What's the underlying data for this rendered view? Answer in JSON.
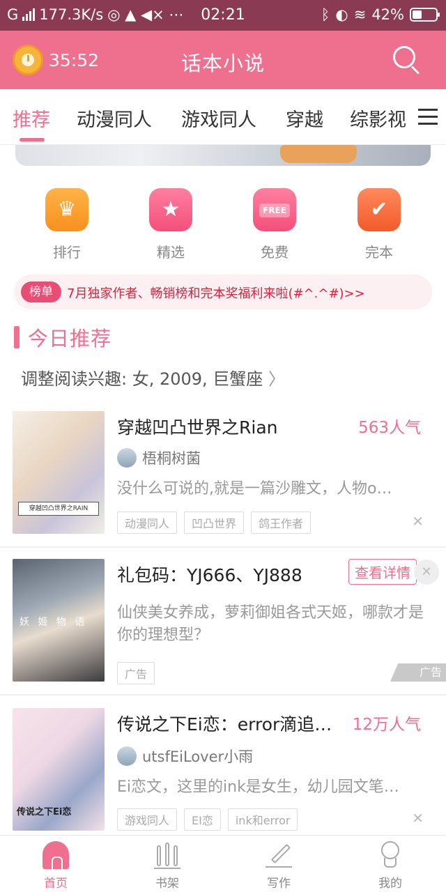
{
  "status_bar": {
    "carrier": "G",
    "speed": "177.3K/s",
    "time": "02:21",
    "battery": "42%",
    "battery_level": 0.42
  },
  "header": {
    "timer": "35:52",
    "title": "话本小说"
  },
  "tabs": [
    {
      "label": "推荐",
      "active": true
    },
    {
      "label": "动漫同人",
      "active": false
    },
    {
      "label": "游戏同人",
      "active": false
    },
    {
      "label": "穿越",
      "active": false
    },
    {
      "label": "综影视",
      "active": false
    }
  ],
  "quick_entries": [
    {
      "label": "排行",
      "icon": "trophy-icon"
    },
    {
      "label": "精选",
      "icon": "star-icon"
    },
    {
      "label": "免费",
      "icon": "free-icon",
      "badge": "FREE"
    },
    {
      "label": "完本",
      "icon": "checkmark-icon"
    }
  ],
  "notice": {
    "tag": "榜单",
    "text": "7月独家作者、畅销榜和完本奖福利来啦(#^.^#)>>"
  },
  "section": {
    "title": "今日推荐",
    "prefs": "调整阅读兴趣: 女, 2009, 巨蟹座"
  },
  "books": [
    {
      "title": "穿越凹凸世界之Rian",
      "popularity": "563人气",
      "author": "梧桐树菌",
      "desc": "没什么可说的,就是一篇沙雕文，人物o…",
      "tags": [
        "动漫同人",
        "凹凸世界",
        "鸽王作者"
      ],
      "cover_text": "穿越凹凸世界之RAIN"
    },
    {
      "title": "传说之下Ei恋：error滴追…",
      "popularity": "12万人气",
      "author": "utsfEiLover小雨",
      "desc": "Ei恋文，这里的ink是女生，幼儿园文笔…",
      "tags": [
        "游戏同人",
        "EI恋",
        "ink和error"
      ],
      "cover_text": "传说之下Ei恋"
    }
  ],
  "ad": {
    "title": "礼包码：YJ666、YJ888",
    "detail_button": "查看详情",
    "desc": "仙侠美女养成，萝莉御姐各式天姬，哪款才是你的理想型？",
    "tag": "广告",
    "mark": "广告",
    "cover_text": "妖 姬 物 语"
  },
  "bottom_nav": [
    {
      "label": "首页",
      "active": true
    },
    {
      "label": "书架",
      "active": false
    },
    {
      "label": "写作",
      "active": false
    },
    {
      "label": "我的",
      "active": false
    }
  ],
  "colors": {
    "accent": "#ee6f8e",
    "status_bar": "#8a3a52",
    "notice_text": "#d7233d"
  }
}
